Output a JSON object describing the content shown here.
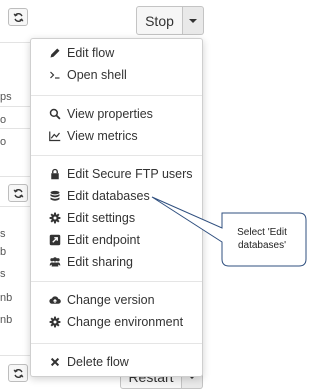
{
  "background": {
    "row_fragments": [
      "ps",
      "o",
      "o",
      "s",
      "b",
      "s",
      "nb",
      "nb"
    ]
  },
  "toolbar": {
    "stop_label": "Stop",
    "restart_label": "Restart"
  },
  "menu": {
    "items": [
      {
        "label": "Edit flow",
        "icon": "pencil-icon"
      },
      {
        "label": "Open shell",
        "icon": "terminal-icon"
      },
      {
        "label": "View properties",
        "icon": "search-icon"
      },
      {
        "label": "View metrics",
        "icon": "line-chart-icon"
      },
      {
        "label": "Edit Secure FTP users",
        "icon": "lock-icon"
      },
      {
        "label": "Edit databases",
        "icon": "database-icon"
      },
      {
        "label": "Edit settings",
        "icon": "gear-icon"
      },
      {
        "label": "Edit endpoint",
        "icon": "external-link-icon"
      },
      {
        "label": "Edit sharing",
        "icon": "users-icon"
      },
      {
        "label": "Change version",
        "icon": "cloud-upload-icon"
      },
      {
        "label": "Change environment",
        "icon": "gear-icon"
      },
      {
        "label": "Delete flow",
        "icon": "close-icon"
      }
    ]
  },
  "callout": {
    "text_line1": "Select 'Edit",
    "text_line2": "databases'"
  },
  "colors": {
    "callout_border": "#2f4f7f",
    "callout_line": "#4a6fa5"
  }
}
